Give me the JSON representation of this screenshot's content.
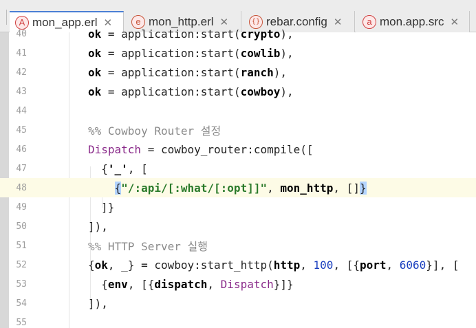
{
  "tabs": [
    {
      "label": "mon_app.erl",
      "icon": "A",
      "active": true
    },
    {
      "label": "mon_http.erl",
      "icon": "e",
      "active": false
    },
    {
      "label": "rebar.config",
      "icon": "{}",
      "active": false
    },
    {
      "label": "mon.app.src",
      "icon": "a",
      "active": false
    }
  ],
  "close_glyph": "✕",
  "lines": [
    {
      "no": "40",
      "text": "ok = application:start(crypto),"
    },
    {
      "no": "41",
      "text": "ok = application:start(cowlib),"
    },
    {
      "no": "42",
      "text": "ok = application:start(ranch),"
    },
    {
      "no": "43",
      "text": "ok = application:start(cowboy),"
    },
    {
      "no": "44",
      "text": ""
    },
    {
      "no": "45",
      "text": "%% Cowboy Router 설정"
    },
    {
      "no": "46",
      "text": "Dispatch = cowboy_router:compile(["
    },
    {
      "no": "47",
      "text": "{'_', ["
    },
    {
      "no": "48",
      "text": "{\"/:api/[:what/[:opt]]\", mon_http, []}"
    },
    {
      "no": "49",
      "text": "]}"
    },
    {
      "no": "50",
      "text": "]),"
    },
    {
      "no": "51",
      "text": "%% HTTP Server 실행"
    },
    {
      "no": "52",
      "text": "{ok, _} = cowboy:start_http(http, 100, [{port, 6060}], ["
    },
    {
      "no": "53",
      "text": "{env, [{dispatch, Dispatch}]}"
    },
    {
      "no": "54",
      "text": "]),"
    },
    {
      "no": "55",
      "text": ""
    }
  ],
  "current_line": "48",
  "colors": {
    "active_tab_accent": "#4a7fd4",
    "current_line_bg": "#fdfbe6",
    "brace_match": "#b3d4ff",
    "comment": "#8a8a8a",
    "variable": "#8a2a8a",
    "number": "#1a3fbf",
    "string": "#2a7a2a"
  }
}
